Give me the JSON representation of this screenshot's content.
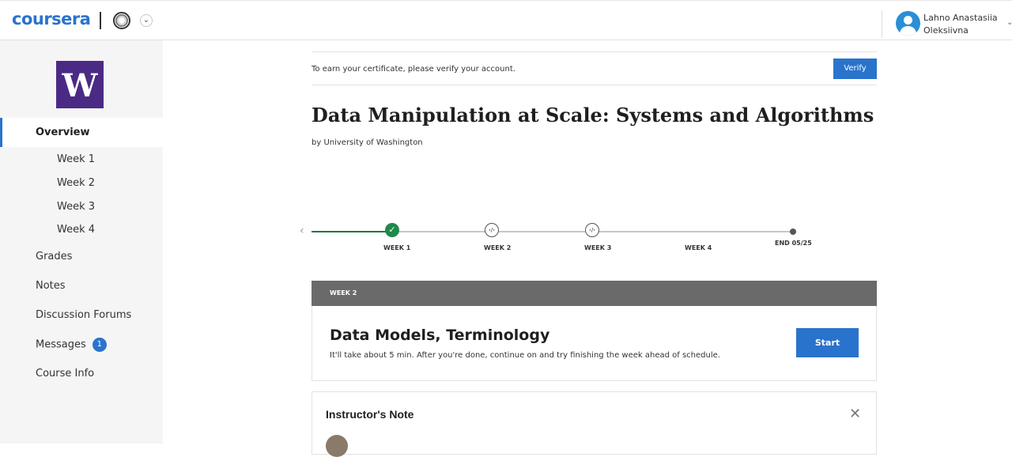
{
  "header": {
    "logo": "coursera",
    "user_name": "Lahno Anastasiia Oleksiivna"
  },
  "sidebar": {
    "logo_letter": "W",
    "items": [
      {
        "label": "Overview"
      },
      {
        "label": "Week 1"
      },
      {
        "label": "Week 2"
      },
      {
        "label": "Week 3"
      },
      {
        "label": "Week 4"
      },
      {
        "label": "Grades"
      },
      {
        "label": "Notes"
      },
      {
        "label": "Discussion Forums"
      },
      {
        "label": "Messages",
        "badge": "1"
      },
      {
        "label": "Course Info"
      }
    ]
  },
  "verify": {
    "text": "To earn your certificate, please verify your account.",
    "button": "Verify"
  },
  "course": {
    "title": "Data Manipulation at Scale: Systems and Algorithms",
    "by": "by University of Washington"
  },
  "timeline": {
    "labels": [
      "WEEK 1",
      "WEEK 2",
      "WEEK 3",
      "WEEK 4",
      "END 05/25"
    ],
    "code_glyph": "‹/›"
  },
  "week_card": {
    "label": "WEEK 2",
    "title": "Data Models, Terminology",
    "description": "It'll take about 5 min. After you're done, continue on and try finishing the week ahead of schedule.",
    "button": "Start"
  },
  "note": {
    "title": "Instructor's Note"
  },
  "colors": {
    "accent": "#2a73cc",
    "complete": "#1f8a4c",
    "sidebar_bg": "#f5f5f5",
    "uw_purple": "#4b2a85"
  }
}
